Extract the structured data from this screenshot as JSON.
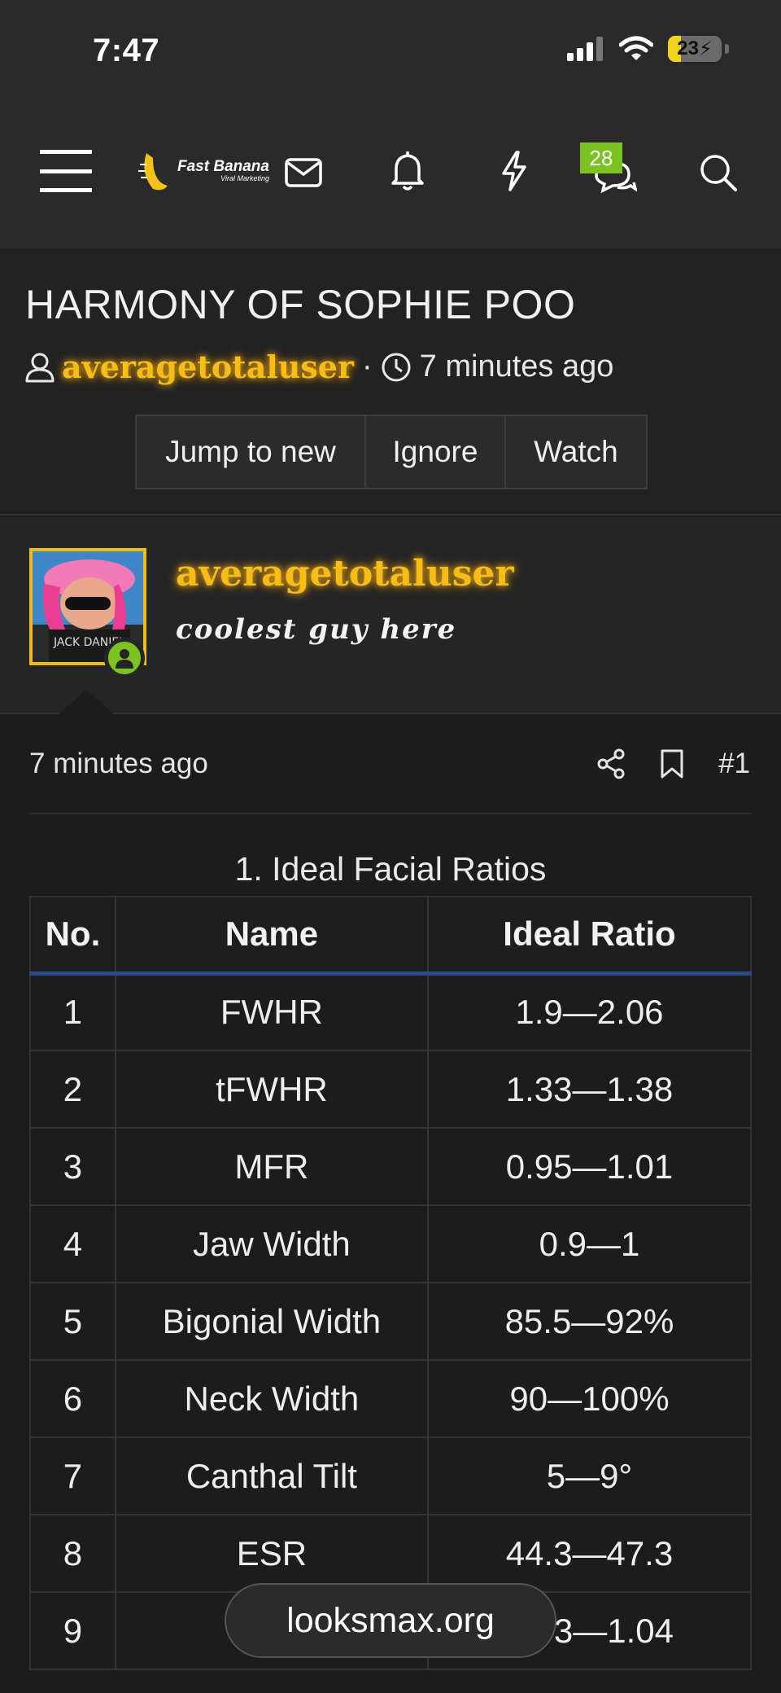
{
  "status": {
    "time": "7:47",
    "battery": "23"
  },
  "nav": {
    "logo_text": "Fast Banana",
    "logo_sub": "Viral Marketing",
    "chat_badge": "28"
  },
  "thread": {
    "title": "HARMONY OF SOPHIE POO",
    "author": "averagetotaluser",
    "separator": "·",
    "time": "7 minutes ago",
    "buttons": [
      "Jump to new",
      "Ignore",
      "Watch"
    ]
  },
  "user": {
    "name": "averagetotaluser",
    "title": "coolest guy here"
  },
  "post": {
    "time": "7 minutes ago",
    "number": "#1",
    "caption": "1. Ideal Facial Ratios",
    "table": {
      "headers": [
        "No.",
        "Name",
        "Ideal Ratio"
      ],
      "rows": [
        [
          "1",
          "FWHR",
          "1.9—2.06"
        ],
        [
          "2",
          "tFWHR",
          "1.33—1.38"
        ],
        [
          "3",
          "MFR",
          "0.95—1.01"
        ],
        [
          "4",
          "Jaw Width",
          "0.9—1"
        ],
        [
          "5",
          "Bigonial Width",
          "85.5—92%"
        ],
        [
          "6",
          "Neck Width",
          "90—100%"
        ],
        [
          "7",
          "Canthal Tilt",
          "5—9°"
        ],
        [
          "8",
          "ESR",
          "44.3—47.3"
        ],
        [
          "9",
          "",
          "3—1.04"
        ]
      ]
    }
  },
  "site_pill": "looksmax.org"
}
